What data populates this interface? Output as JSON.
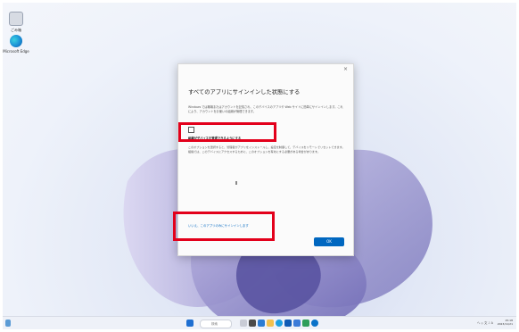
{
  "desktop": {
    "icons": [
      {
        "name": "recycle-bin",
        "label": "ごみ箱"
      },
      {
        "name": "edge",
        "label": "Microsoft Edge"
      }
    ]
  },
  "dialog": {
    "close": "×",
    "title": "すべてのアプリにサインインした状態にする",
    "description": "Windows では職場またはアカウントを記憶され、このデバイスのアプリや Web サイトに簡単にサインインします。これにより、アカウントをお使いの組織が管理できます。",
    "checkbox_label": "組織がデバイスを管理できるようにする",
    "note": "このオプションを選択すると、管理者がアプリをインストールし、設定を制御して、デバイスをリモートでリセットできます。組織では、このデバイスにアクセスするために、このオプションを有効にする必要がある場合があります。",
    "link_text": "いいえ、このアプリのみにサインインします",
    "ok_label": "OK"
  },
  "taskbar": {
    "search_placeholder": "検索",
    "tray_text": "へ ◇ 文 ♪ A",
    "time": "15:18",
    "date": "2023/11/21"
  },
  "colors": {
    "highlight": "#e3001b",
    "accent": "#0067c0"
  }
}
